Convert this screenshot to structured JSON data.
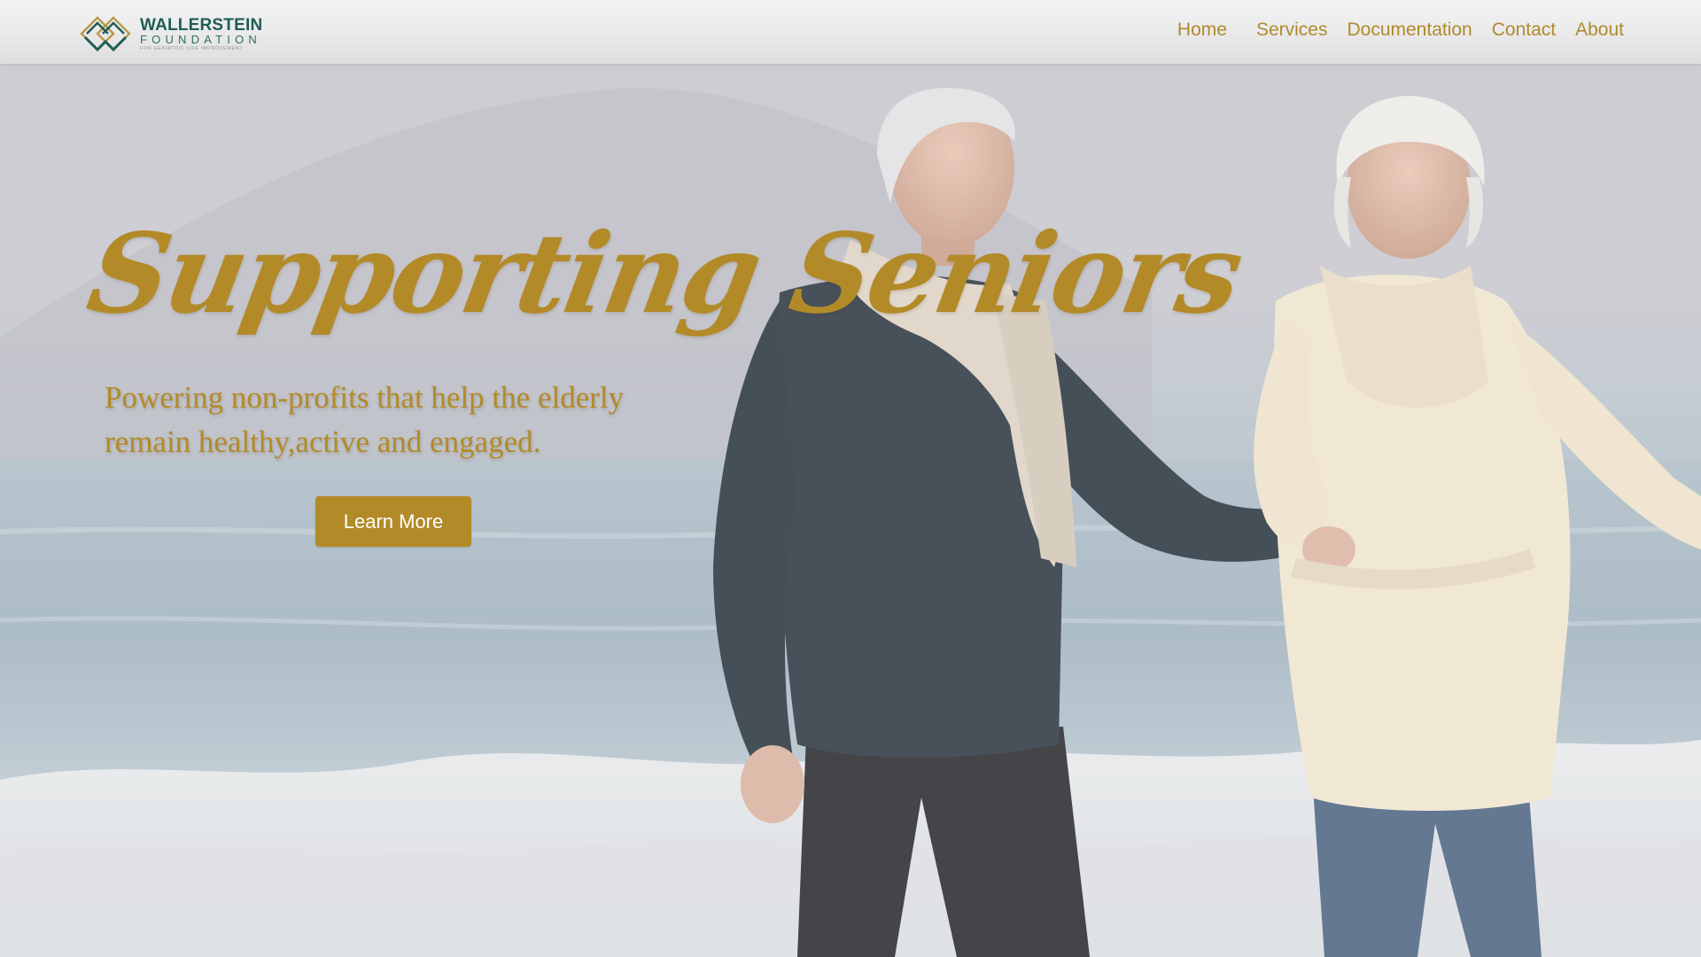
{
  "brand": {
    "name": "WALLERSTEIN",
    "subname": "FOUNDATION",
    "tagline": "FOR GERIATRIC LIFE IMPROVEMENT",
    "icon": "diamond-logo-icon",
    "colors": {
      "primary": "#1f5d55",
      "accent": "#b38a28"
    }
  },
  "nav": {
    "items": [
      {
        "label": "Home"
      },
      {
        "label": "Services"
      },
      {
        "label": "Documentation"
      },
      {
        "label": "Contact"
      },
      {
        "label": "About"
      }
    ]
  },
  "hero": {
    "title": "Supporting Seniors",
    "subtitle": "Powering non-profits that help the elderly remain healthy,active and engaged.",
    "cta_label": "Learn More",
    "background_image": "hero-photo-senior-couple-beach"
  }
}
